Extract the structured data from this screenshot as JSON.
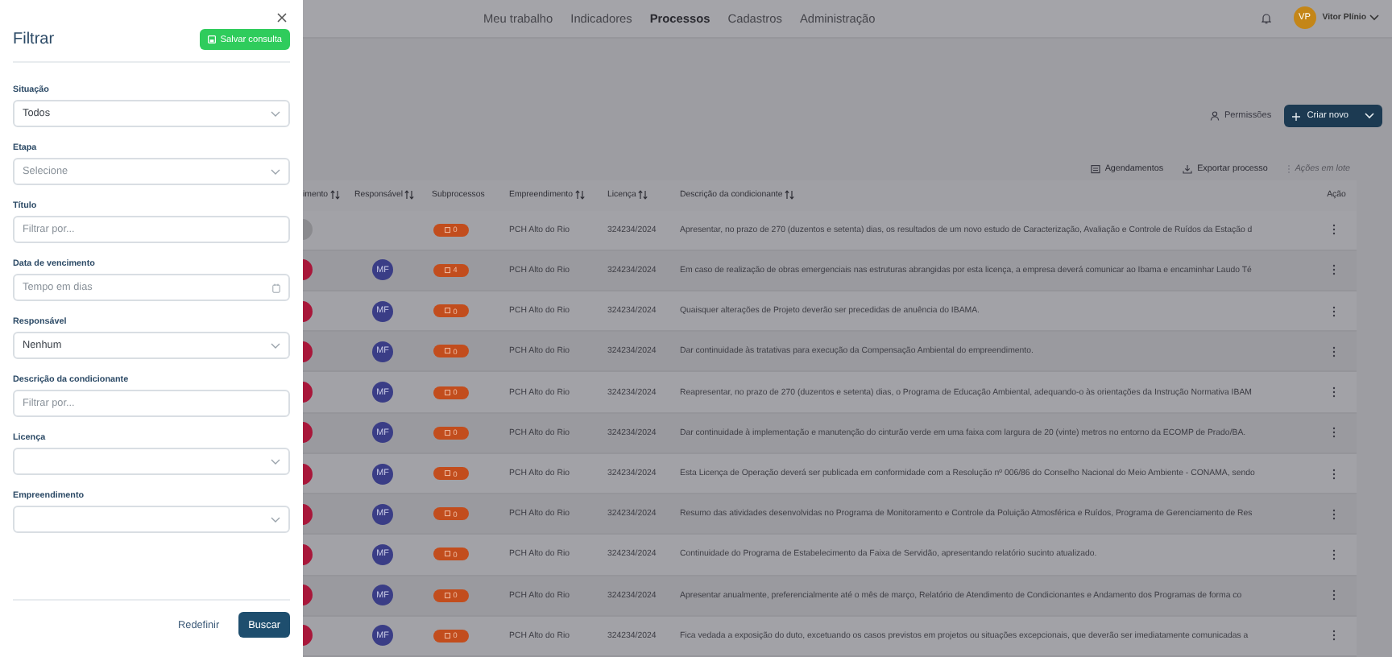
{
  "drawer": {
    "title": "Filtrar",
    "save_button": "Salvar consulta",
    "fields": [
      {
        "kind": "select",
        "label": "Situação",
        "value": "Todos"
      },
      {
        "kind": "select",
        "label": "Etapa",
        "placeholder": "Selecione"
      },
      {
        "kind": "input",
        "label": "Título",
        "placeholder": "Filtrar por..."
      },
      {
        "kind": "date",
        "label": "Data de vencimento",
        "placeholder": "Tempo em dias"
      },
      {
        "kind": "select",
        "label": "Responsável",
        "value": "Nenhum"
      },
      {
        "kind": "input",
        "label": "Descrição da condicionante",
        "placeholder": "Filtrar por..."
      },
      {
        "kind": "select",
        "label": "Licença"
      },
      {
        "kind": "select",
        "label": "Empreendimento"
      }
    ],
    "reset_button": "Redefinir",
    "search_button": "Buscar"
  },
  "nav": {
    "items": [
      {
        "label": "Meu trabalho",
        "selected": false
      },
      {
        "label": "Indicadores",
        "selected": false
      },
      {
        "label": "Processos",
        "selected": true
      },
      {
        "label": "Cadastros",
        "selected": false
      },
      {
        "label": "Administração",
        "selected": false
      }
    ],
    "user": {
      "initials": "VP",
      "name": "Vitor Plínio"
    }
  },
  "toolbar": {
    "permissions": "Permissões",
    "create_button": "Criar novo",
    "actions": [
      {
        "kind": "schedule",
        "label": "Agendamentos",
        "disabled": false
      },
      {
        "kind": "export",
        "label": "Exportar processo",
        "disabled": false
      },
      {
        "kind": "batch",
        "label": "Ações em lote",
        "disabled": true
      }
    ]
  },
  "table": {
    "columns": [
      {
        "label": "imento",
        "sortable": true
      },
      {
        "label": "Responsável",
        "sortable": true
      },
      {
        "label": "Subprocessos",
        "sortable": false
      },
      {
        "label": "Empreendimento",
        "sortable": true
      },
      {
        "label": "Licença",
        "sortable": true
      },
      {
        "label": "Descrição da condicionante",
        "sortable": true
      },
      {
        "label": "Ação",
        "sortable": false
      }
    ],
    "rows": [
      {
        "color": "#8a8a8e",
        "subprocesses": "0",
        "enterprise": "PCH Alto do Rio",
        "license": "324234/2024",
        "description": "Apresentar, no prazo de 270 (duzentos e setenta) dias, os resultados de um novo estudo de Caracterização, Avaliação e Controle de Ruídos da Estação d"
      },
      {
        "color": "#a8173a",
        "responsible": "MF",
        "subprocesses": "4",
        "enterprise": "PCH Alto do Rio",
        "license": "324234/2024",
        "description": "Em caso de realização de obras emergenciais nas estruturas abrangidas por esta licença, a empresa deverá comunicar ao Ibama e encaminhar Laudo Té"
      },
      {
        "color": "#a8173a",
        "responsible": "MF",
        "subprocesses": "0",
        "enterprise": "PCH Alto do Rio",
        "license": "324234/2024",
        "description": "Quaisquer alterações de Projeto deverão ser precedidas de anuência do IBAMA."
      },
      {
        "color": "#a8173a",
        "responsible": "MF",
        "subprocesses": "0",
        "enterprise": "PCH Alto do Rio",
        "license": "324234/2024",
        "description": "Dar continuidade às tratativas para execução da Compensação Ambiental do empreendimento."
      },
      {
        "color": "#a8173a",
        "responsible": "MF",
        "subprocesses": "0",
        "enterprise": "PCH Alto do Rio",
        "license": "324234/2024",
        "description": "Reapresentar, no prazo de 270 (duzentos e setenta) dias, o Programa de Educação Ambiental, adequando-o às orientações da Instrução Normativa IBAM"
      },
      {
        "color": "#a8173a",
        "responsible": "MF",
        "subprocesses": "0",
        "enterprise": "PCH Alto do Rio",
        "license": "324234/2024",
        "description": "Dar continuidade à implementação e manutenção do cinturão verde em uma faixa com largura de 20 (vinte) metros no entorno da ECOMP de Prado/BA."
      },
      {
        "color": "#a8173a",
        "responsible": "MF",
        "subprocesses": "0",
        "enterprise": "PCH Alto do Rio",
        "license": "324234/2024",
        "description": "Esta Licença de Operação deverá ser publicada em conformidade com a Resolução nº 006/86 do Conselho Nacional do Meio Ambiente - CONAMA, sendo"
      },
      {
        "color": "#a8173a",
        "responsible": "MF",
        "subprocesses": "0",
        "enterprise": "PCH Alto do Rio",
        "license": "324234/2024",
        "description": "Resumo das atividades desenvolvidas no Programa de Monitoramento e Controle da Poluição Atmosférica e Ruídos, Programa de Gerenciamento de Res"
      },
      {
        "color": "#a8173a",
        "responsible": "MF",
        "subprocesses": "0",
        "enterprise": "PCH Alto do Rio",
        "license": "324234/2024",
        "description": "Continuidade do Programa de Estabelecimento da Faixa de Servidão, apresentando relatório sucinto atualizado."
      },
      {
        "color": "#a8173a",
        "responsible": "MF",
        "subprocesses": "0",
        "enterprise": "PCH Alto do Rio",
        "license": "324234/2024",
        "description": "Apresentar anualmente, preferencialmente até o mês de março, Relatório de Atendimento de Condicionantes e Andamento dos Programas de forma co"
      },
      {
        "color": "#a8173a",
        "responsible": "MF",
        "subprocesses": "0",
        "enterprise": "PCH Alto do Rio",
        "license": "324234/2024",
        "description": "Fica vedada a exposição do duto, excetuando os casos previstos em projetos ou situações excepcionais, que deverão ser imediatamente comunicadas a"
      }
    ]
  }
}
